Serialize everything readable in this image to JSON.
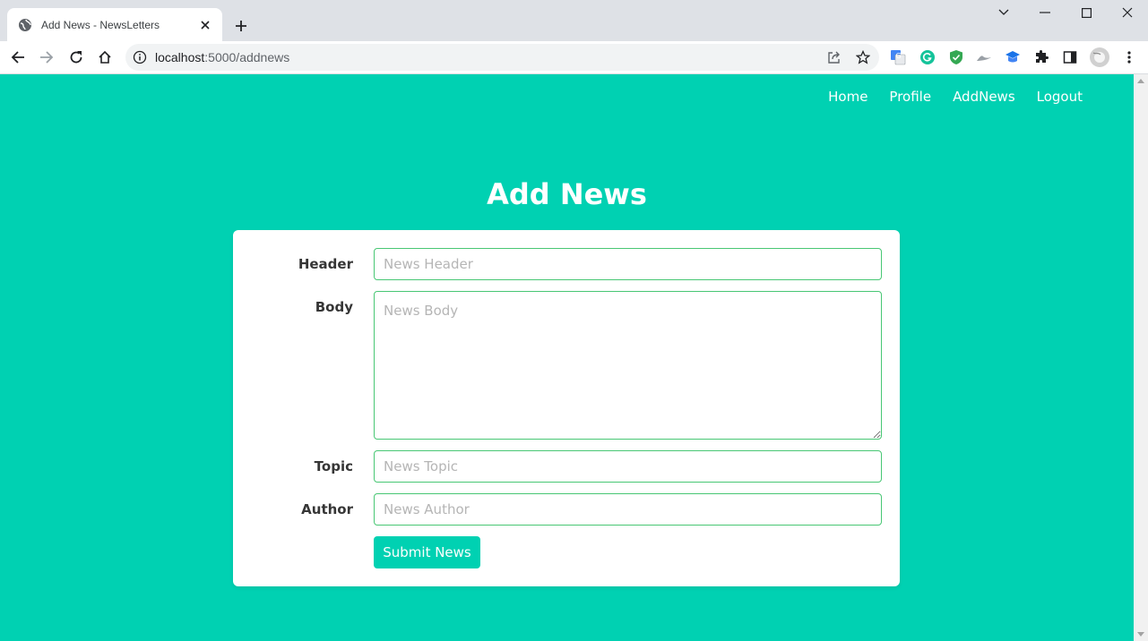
{
  "browser": {
    "tab_title": "Add News - NewsLetters",
    "url_host": "localhost",
    "url_path": ":5000/addnews"
  },
  "nav": {
    "links": [
      "Home",
      "Profile",
      "AddNews",
      "Logout"
    ]
  },
  "page": {
    "title": "Add News"
  },
  "form": {
    "header_label": "Header",
    "header_placeholder": "News Header",
    "body_label": "Body",
    "body_placeholder": "News Body",
    "topic_label": "Topic",
    "topic_placeholder": "News Topic",
    "author_label": "Author",
    "author_placeholder": "News Author",
    "submit_label": "Submit News"
  },
  "colors": {
    "primary": "#00d1b2",
    "field_border": "#48c774"
  },
  "icons": [
    "globe-icon",
    "close-icon",
    "plus-icon",
    "chevron-down-icon",
    "minimize-icon",
    "maximize-icon",
    "window-close-icon",
    "back-icon",
    "forward-icon",
    "reload-icon",
    "home-icon",
    "info-icon",
    "share-icon",
    "star-icon",
    "translate-icon",
    "grammarly-icon",
    "shield-icon",
    "hat-icon",
    "graduation-icon",
    "puzzle-icon",
    "sidepanel-icon",
    "profile-avatar",
    "menu-dots-icon"
  ]
}
